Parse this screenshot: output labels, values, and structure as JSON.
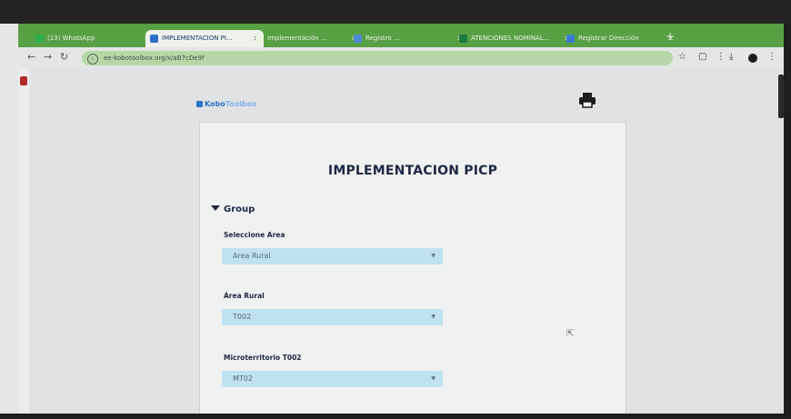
{
  "browser": {
    "tabs": [
      {
        "label": "(13) WhatsApp"
      },
      {
        "label": "IMPLEMENTACION PI..."
      },
      {
        "label": "Implementación ..."
      },
      {
        "label": "Registro ..."
      },
      {
        "label": "ATENCIONES NOMINAL..."
      },
      {
        "label": "Registrar Dirección"
      }
    ],
    "new_tab_label": "+",
    "url": "ee-kobotoolbox.org/x/aB7cDe9f"
  },
  "page": {
    "logo_bold": "Kobo",
    "logo_light": "Toolbox",
    "form_title": "IMPLEMENTACION PICP",
    "group_label": "Group",
    "fields": [
      {
        "label": "Seleccione Area",
        "value": "Area Rural"
      },
      {
        "label": "Área Rural",
        "value": "T002"
      },
      {
        "label": "Microterritorio T002",
        "value": "MT02"
      }
    ]
  },
  "colors": {
    "tab_bar": "#58a044",
    "accent": "#2e73c8",
    "select_bg": "#bfe2ef"
  },
  "icons": [
    "back-icon",
    "forward-icon",
    "reload-icon",
    "site-info-icon",
    "star-icon",
    "print-icon",
    "download-icon",
    "menu-icon",
    "cursor-icon"
  ]
}
